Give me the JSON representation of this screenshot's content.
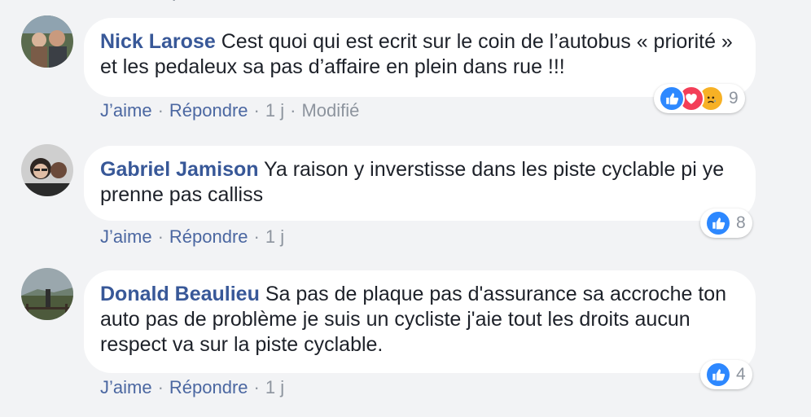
{
  "colors": {
    "author": "#385898",
    "link": "#4b67a1",
    "muted": "#8d949e",
    "like_blue": "#2d88ff",
    "love_red": "#f33e58",
    "sad_yellow": "#f7b125"
  },
  "top_fragment": "·",
  "comments": [
    {
      "author": "Nick Larose",
      "text": "Cest quoi qui est ecrit sur le coin de l’autobus « priorité » et les pedaleux sa pas d’affaire en plein dans rue !!!",
      "like_label": "J’aime",
      "reply_label": "Répondre",
      "time": "1 j",
      "edited": "Modifié",
      "reactions": [
        "like-icon",
        "love-icon",
        "sad-icon"
      ],
      "reaction_count": "9"
    },
    {
      "author": "Gabriel Jamison",
      "text": "Ya raison y inverstisse dans les piste cyclable pi ye prenne pas calliss",
      "like_label": "J’aime",
      "reply_label": "Répondre",
      "time": "1 j",
      "reactions": [
        "like-icon"
      ],
      "reaction_count": "8"
    },
    {
      "author": "Donald Beaulieu",
      "text": "Sa pas de plaque pas d'assurance sa accroche ton auto pas de problème je suis un cycliste j'aie tout les droits aucun respect va sur la piste cyclable.",
      "like_label": "J’aime",
      "reply_label": "Répondre",
      "time": "1 j",
      "reactions": [
        "like-icon"
      ],
      "reaction_count": "4"
    }
  ]
}
